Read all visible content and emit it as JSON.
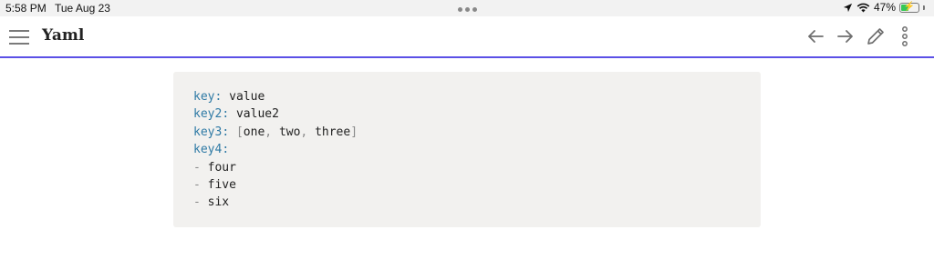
{
  "status_bar": {
    "time": "5:58 PM",
    "date": "Tue Aug 23",
    "battery_percent": "47%",
    "battery_level": 0.47,
    "icons": [
      "location-icon",
      "wifi-icon",
      "battery-charging-icon"
    ]
  },
  "toolbar": {
    "title": "Yaml",
    "accent_color": "#5b50e6",
    "icons": [
      "menu-icon",
      "back-arrow-icon",
      "forward-arrow-icon",
      "edit-pencil-icon",
      "more-vertical-icon"
    ]
  },
  "code": {
    "language": "yaml",
    "colors": {
      "key": "#2f7aa5",
      "punctuation": "#8a8a8a",
      "value": "#222222",
      "background": "#f2f1ef"
    },
    "lines": {
      "l1": {
        "key": "key",
        "colon": ":",
        "value": "value"
      },
      "l2": {
        "key": "key2",
        "colon": ":",
        "value": "value2"
      },
      "l3": {
        "key": "key3",
        "colon": ":",
        "open": "[",
        "items": [
          "one",
          "two",
          "three"
        ],
        "comma": ",",
        "close": "]"
      },
      "l4": {
        "key": "key4",
        "colon": ":"
      },
      "list": [
        {
          "dash": "-",
          "value": "four"
        },
        {
          "dash": "-",
          "value": "five"
        },
        {
          "dash": "-",
          "value": "six"
        }
      ]
    }
  }
}
